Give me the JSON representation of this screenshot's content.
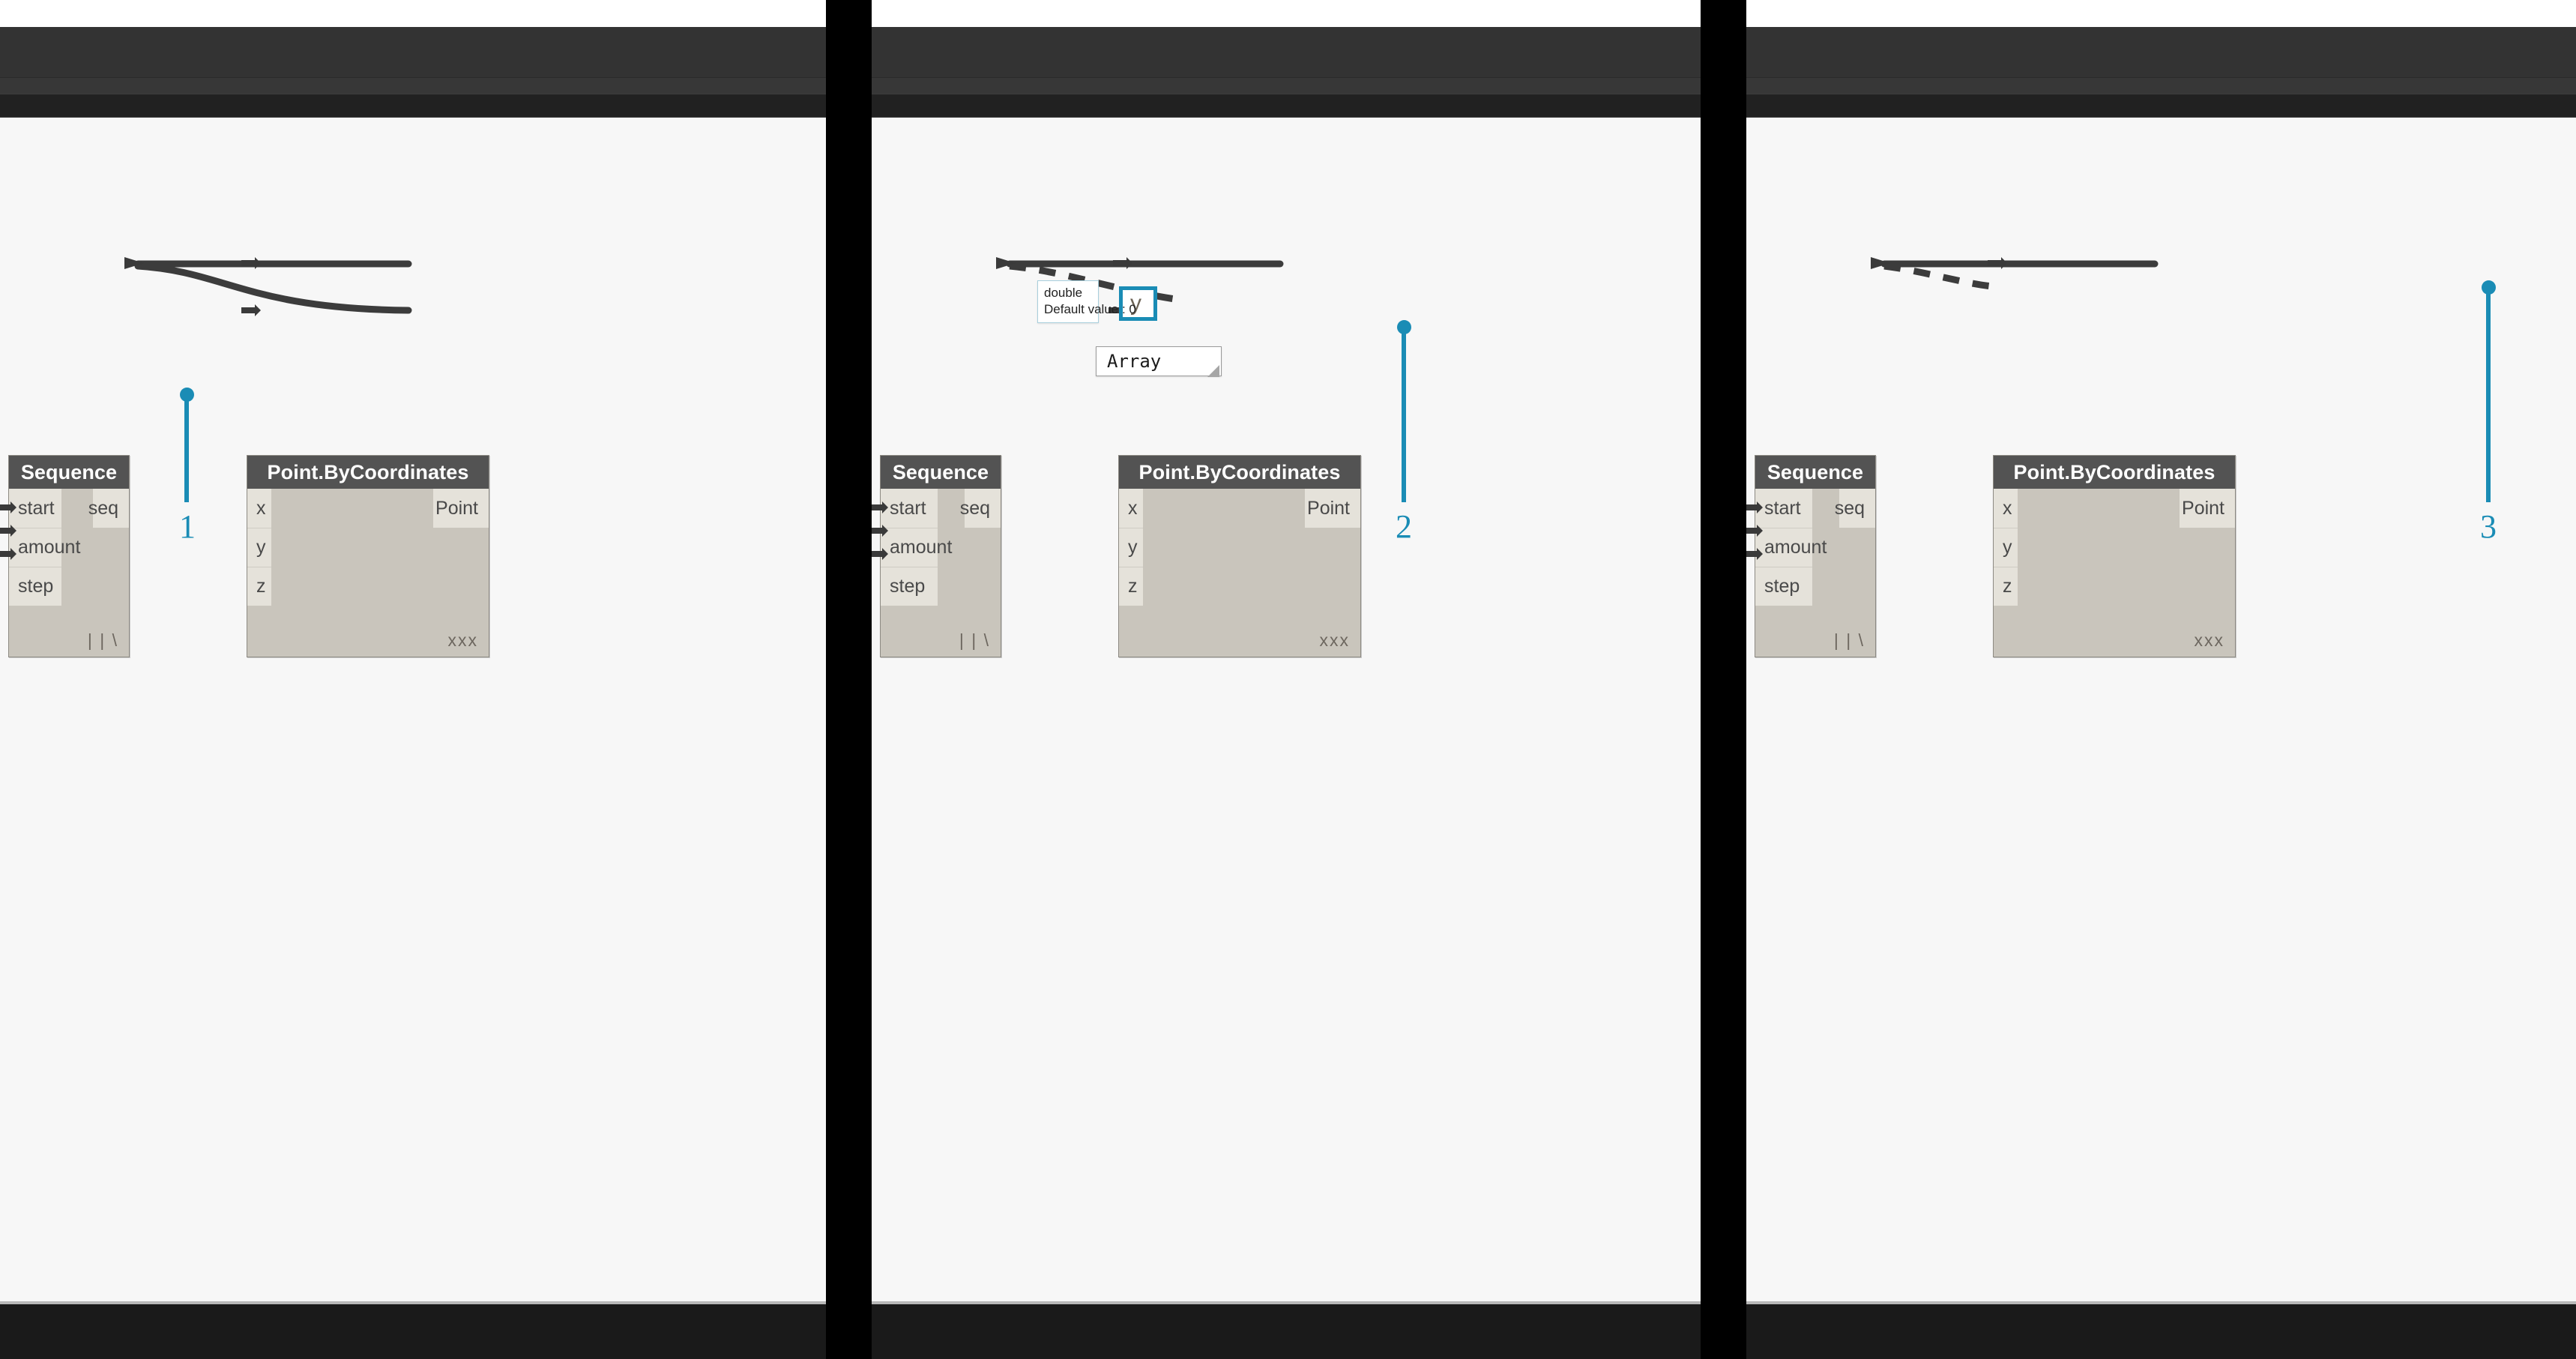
{
  "accent_color": "#1a8cb5",
  "node_header_color": "#535353",
  "node_body_color": "#c9c5bc",
  "node_port_color": "#e5e2da",
  "canvas_color": "#f7f7f7",
  "panels": [
    {
      "id": "panel-1",
      "callout": "1",
      "sequence_node": {
        "title": "Sequence",
        "inputs": [
          "start",
          "amount",
          "step"
        ],
        "outputs": [
          "seq"
        ],
        "lacing": "| | \\"
      },
      "point_node": {
        "title": "Point.ByCoordinates",
        "inputs": [
          "x",
          "y",
          "z"
        ],
        "outputs": [
          "Point"
        ],
        "lacing": "xxx"
      },
      "wires": [
        {
          "from": "seq",
          "to": "x",
          "style": "solid"
        },
        {
          "from": "seq",
          "to": "y",
          "style": "solid"
        }
      ]
    },
    {
      "id": "panel-2",
      "callout": "2",
      "sequence_node": {
        "title": "Sequence",
        "inputs": [
          "start",
          "amount",
          "step"
        ],
        "outputs": [
          "seq"
        ],
        "lacing": "| | \\"
      },
      "point_node": {
        "title": "Point.ByCoordinates",
        "inputs": [
          "x",
          "y",
          "z"
        ],
        "outputs": [
          "Point"
        ],
        "lacing": "xxx"
      },
      "wires": [
        {
          "from": "seq",
          "to": "x",
          "style": "solid"
        },
        {
          "from": "seq",
          "to": "drag",
          "style": "dashed"
        }
      ],
      "tooltip": {
        "type_line": "double",
        "default_line": "Default value : 0"
      },
      "highlighted_port": "y",
      "array_box": {
        "value": "Array"
      }
    },
    {
      "id": "panel-3",
      "callout": "3",
      "sequence_node": {
        "title": "Sequence",
        "inputs": [
          "start",
          "amount",
          "step"
        ],
        "outputs": [
          "seq"
        ],
        "lacing": "| | \\"
      },
      "point_node": {
        "title": "Point.ByCoordinates",
        "inputs": [
          "x",
          "y",
          "z"
        ],
        "outputs": [
          "Point"
        ],
        "lacing": "xxx"
      },
      "wires": [
        {
          "from": "seq",
          "to": "x",
          "style": "solid"
        },
        {
          "from": "seq",
          "to": "drag",
          "style": "dashed"
        }
      ]
    }
  ]
}
